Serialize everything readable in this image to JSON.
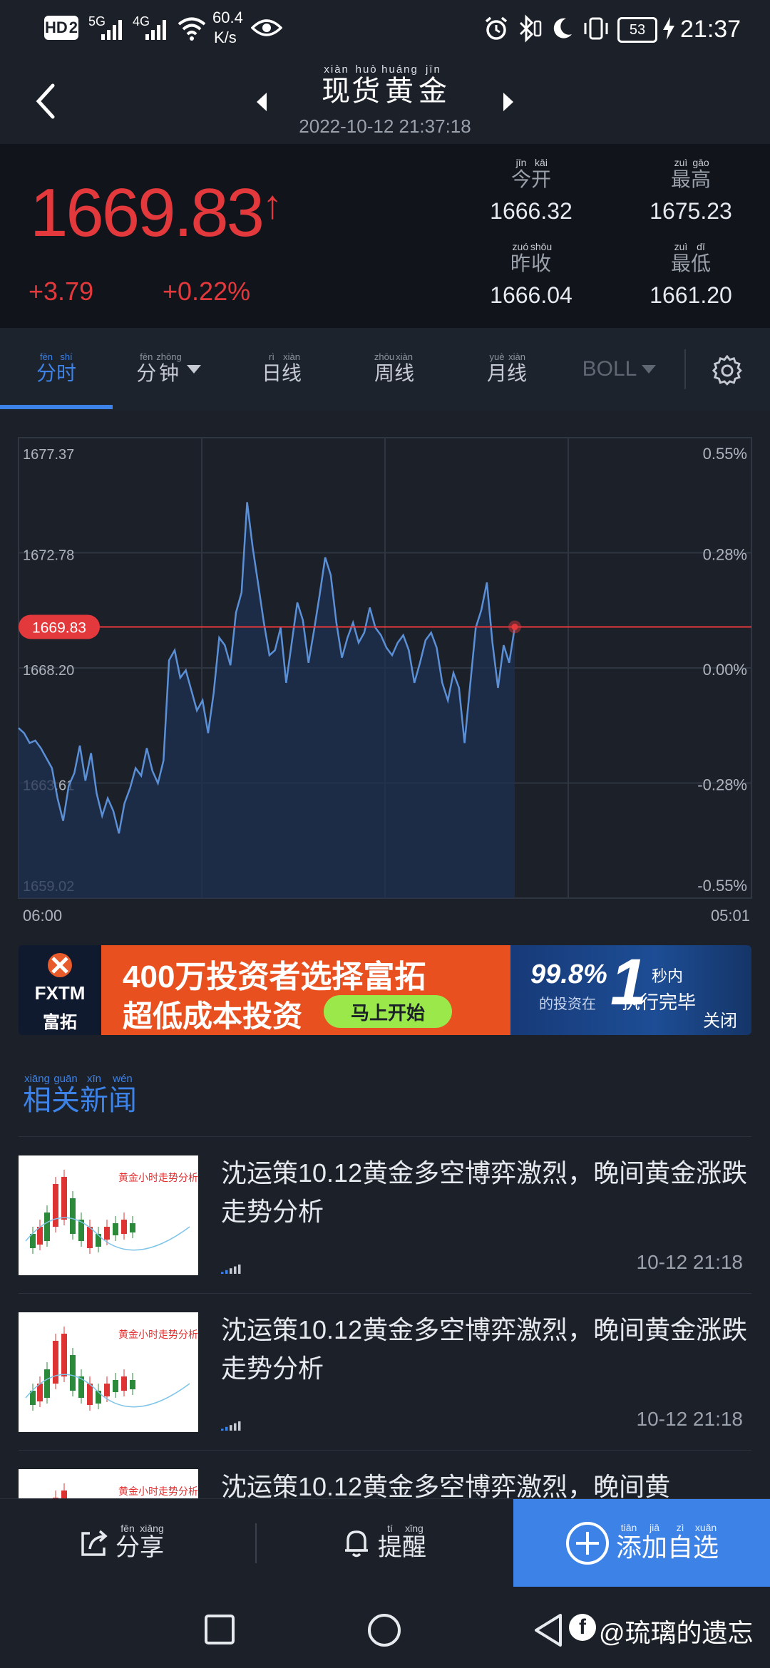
{
  "status_bar": {
    "hd": "HD",
    "sim": "2",
    "net1": "5G",
    "net2": "4G",
    "speed_value": "60.4",
    "speed_unit": "K/s",
    "battery": "53",
    "time": "21:37"
  },
  "header": {
    "title_chars": [
      {
        "c": "现",
        "p": "xiàn"
      },
      {
        "c": "货",
        "p": "huò"
      },
      {
        "c": "黄",
        "p": "huáng"
      },
      {
        "c": "金",
        "p": "jīn"
      }
    ],
    "datetime": "2022-10-12 21:37:18"
  },
  "quote": {
    "price": "1669.83",
    "arrow": "↑",
    "change": "+3.79",
    "change_pct": "+0.22%",
    "open_label": {
      "c": "今开",
      "p": "jīn kāi"
    },
    "open": "1666.32",
    "high_label": {
      "c": "最高",
      "p": "zuì gāo"
    },
    "high": "1675.23",
    "prev_label": {
      "c": "昨收",
      "p": "zuó shōu"
    },
    "prev": "1666.04",
    "low_label": {
      "c": "最低",
      "p": "zuì dī"
    },
    "low": "1661.20"
  },
  "tabs": [
    {
      "label": "分时",
      "p": "fēn shí",
      "active": true
    },
    {
      "label": "分钟",
      "p": "fēn zhōng",
      "dropdown": true
    },
    {
      "label": "日线",
      "p": "rì xiàn"
    },
    {
      "label": "周线",
      "p": "zhōu xiàn"
    },
    {
      "label": "月线",
      "p": "yuè xiàn"
    },
    {
      "label": "BOLL",
      "dropdown": true
    }
  ],
  "chart_data": {
    "type": "area",
    "y_labels": [
      "1677.37",
      "1672.78",
      "1668.20",
      "1663.61",
      "1659.02"
    ],
    "y_right_labels": [
      "0.55%",
      "0.28%",
      "0.00%",
      "-0.28%",
      "-0.55%"
    ],
    "x_labels": [
      "06:00",
      "05:01"
    ],
    "current_price_tag": "1669.83",
    "ylim": [
      1659.02,
      1677.37
    ],
    "values": [
      1665.8,
      1665.6,
      1665.2,
      1665.3,
      1665.0,
      1664.6,
      1664.2,
      1663.0,
      1662.1,
      1663.5,
      1664.0,
      1665.1,
      1663.7,
      1664.8,
      1663.2,
      1662.3,
      1663.0,
      1662.5,
      1661.6,
      1662.8,
      1663.4,
      1664.2,
      1663.9,
      1665.0,
      1664.1,
      1663.6,
      1664.5,
      1668.5,
      1668.9,
      1667.8,
      1668.1,
      1667.3,
      1666.5,
      1666.9,
      1665.6,
      1667.2,
      1669.4,
      1669.1,
      1668.3,
      1670.4,
      1671.2,
      1674.8,
      1673.0,
      1671.5,
      1670.0,
      1668.7,
      1668.9,
      1669.8,
      1667.6,
      1669.2,
      1670.8,
      1670.1,
      1668.4,
      1669.7,
      1671.1,
      1672.6,
      1671.9,
      1670.0,
      1668.6,
      1669.4,
      1670.0,
      1669.2,
      1669.6,
      1670.6,
      1669.8,
      1669.5,
      1669.0,
      1668.7,
      1669.2,
      1669.5,
      1668.9,
      1667.6,
      1668.4,
      1669.3,
      1669.6,
      1669.0,
      1667.6,
      1666.9,
      1668.0,
      1667.4,
      1665.2,
      1667.5,
      1669.8,
      1670.5,
      1671.6,
      1669.2,
      1667.4,
      1669.1,
      1668.4,
      1669.83
    ]
  },
  "ad": {
    "logo_text": "FXTM",
    "logo_cn": "富拓",
    "headline": "400万投资者选择富拓",
    "sub": "超低成本投资",
    "cta": "马上开始",
    "pct": "99.8%",
    "pct_sub": "的投资在",
    "big_num": "1",
    "sec_text": "秒内",
    "exec_text": "执行完毕",
    "close": "关闭"
  },
  "news": {
    "section_title": [
      {
        "c": "相",
        "p": "xiāng"
      },
      {
        "c": "关",
        "p": "guān"
      },
      {
        "c": "新",
        "p": "xīn"
      },
      {
        "c": "闻",
        "p": "wén"
      }
    ],
    "items": [
      {
        "title": "沈运策10.12黄金多空博弈激烈，晚间黄金涨跌走势分析",
        "time": "10-12 21:18",
        "thumb_title": "黄金小时走势分析"
      },
      {
        "title": "沈运策10.12黄金多空博弈激烈，晚间黄金涨跌走势分析",
        "time": "10-12 21:18",
        "thumb_title": "黄金小时走势分析"
      },
      {
        "title": "沈运策10.12黄金多空博弈激烈，晚间黄",
        "time": "",
        "thumb_title": "黄金小时走势分析"
      }
    ]
  },
  "bottom": {
    "share": {
      "c": "分享",
      "p": "fēn xiǎng"
    },
    "remind": {
      "c": "提醒",
      "p": "tí xǐng"
    },
    "add": {
      "c": "添加自选",
      "p": "tiān jiā zì xuǎn"
    }
  },
  "watermark": "@琉璃的遗忘",
  "colors": {
    "accent": "#3d82e6",
    "up_red": "#e4393c",
    "line_blue": "#5b8fd6"
  }
}
